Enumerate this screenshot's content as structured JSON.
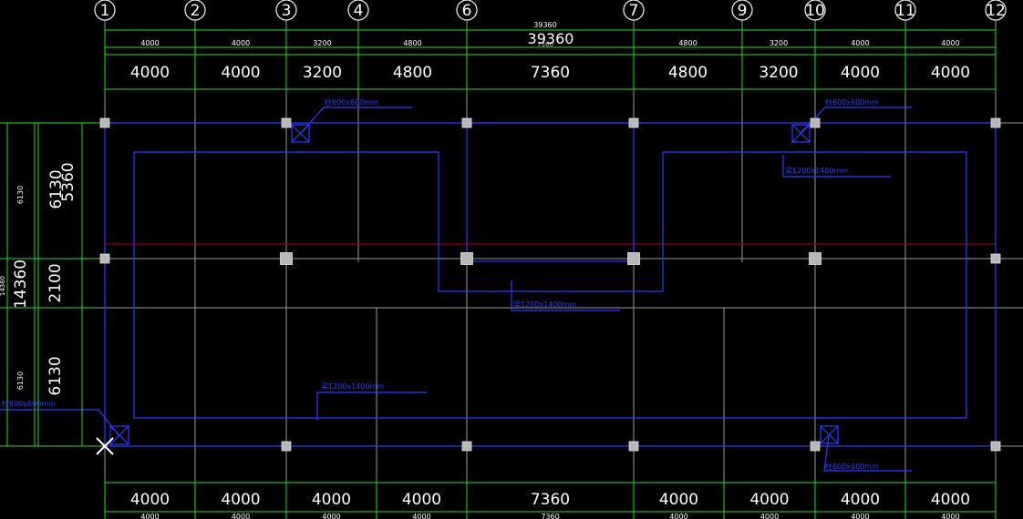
{
  "axes": [
    "1",
    "2",
    "3",
    "4",
    "6",
    "7",
    "9",
    "10",
    "11",
    "12"
  ],
  "top_dims": {
    "total_small": "39360",
    "total_big": "39360",
    "ghost": "7360",
    "small": [
      "4000",
      "4000",
      "3200",
      "4800",
      "",
      "4800",
      "3200",
      "4000",
      "4000"
    ],
    "big": [
      "4000",
      "4000",
      "3200",
      "4800",
      "7360",
      "4800",
      "3200",
      "4000",
      "4000"
    ]
  },
  "bottom_dims": {
    "big": [
      "4000",
      "4000",
      "4000",
      "4000",
      "7360",
      "4000",
      "4000",
      "4000",
      "4000"
    ],
    "small": [
      "4000",
      "4000",
      "4000",
      "4000",
      "7360",
      "4000",
      "4000",
      "4000",
      "4000"
    ]
  },
  "left_dims": {
    "seg_small_top": "6130",
    "seg_small_bottom": "6130",
    "total_big": "14360",
    "total_small": "14360",
    "seg_big": [
      "6130",
      "5360",
      "2100",
      "6130"
    ]
  },
  "labels": {
    "col_tl": "柱600x600mm",
    "col_tr": "柱600x600mm",
    "col_bl": "柱600x600mm",
    "col_br": "柱600x600mm",
    "beam_tr": "梁1200x1400mm",
    "beam_mid": "梁1200x1400mm",
    "beam_bl": "梁1200x1400mm"
  },
  "colors": {
    "background": "#000000",
    "grid_line": "#9a9a9a",
    "dimension": "#22dd22",
    "structure": "#2a3cff",
    "beam_red": "#b00000",
    "text": "#ffffff",
    "column_fill": "#b8b8b8"
  }
}
